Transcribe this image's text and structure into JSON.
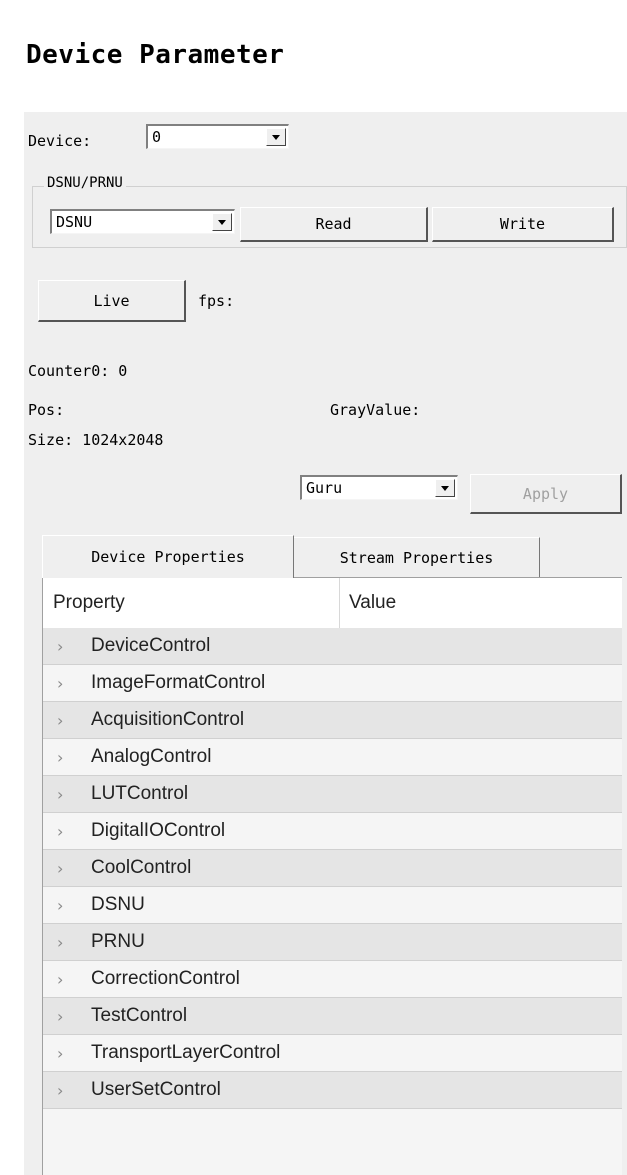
{
  "title": "Device Parameter",
  "device": {
    "label": "Device:",
    "selected": "0"
  },
  "dsnu_prnu": {
    "group_title": "DSNU/PRNU",
    "selected": "DSNU",
    "read_label": "Read",
    "write_label": "Write"
  },
  "live": {
    "button_label": "Live",
    "fps_label": "fps:"
  },
  "status": {
    "counter": "Counter0: 0",
    "pos": "Pos:",
    "gray_value": "GrayValue:",
    "size": "Size: 1024x2048"
  },
  "visibility": {
    "selected": "Guru",
    "apply_label": "Apply"
  },
  "tabs": [
    {
      "label": "Device Properties",
      "active": true
    },
    {
      "label": "Stream Properties",
      "active": false
    }
  ],
  "grid": {
    "columns": [
      "Property",
      "Value"
    ],
    "rows": [
      "DeviceControl",
      "ImageFormatControl",
      "AcquisitionControl",
      "AnalogControl",
      "LUTControl",
      "DigitalIOControl",
      "CoolControl",
      "DSNU",
      "PRNU",
      "CorrectionControl",
      "TestControl",
      "TransportLayerControl",
      "UserSetControl"
    ],
    "expand_icon": "chevron-right-icon"
  }
}
